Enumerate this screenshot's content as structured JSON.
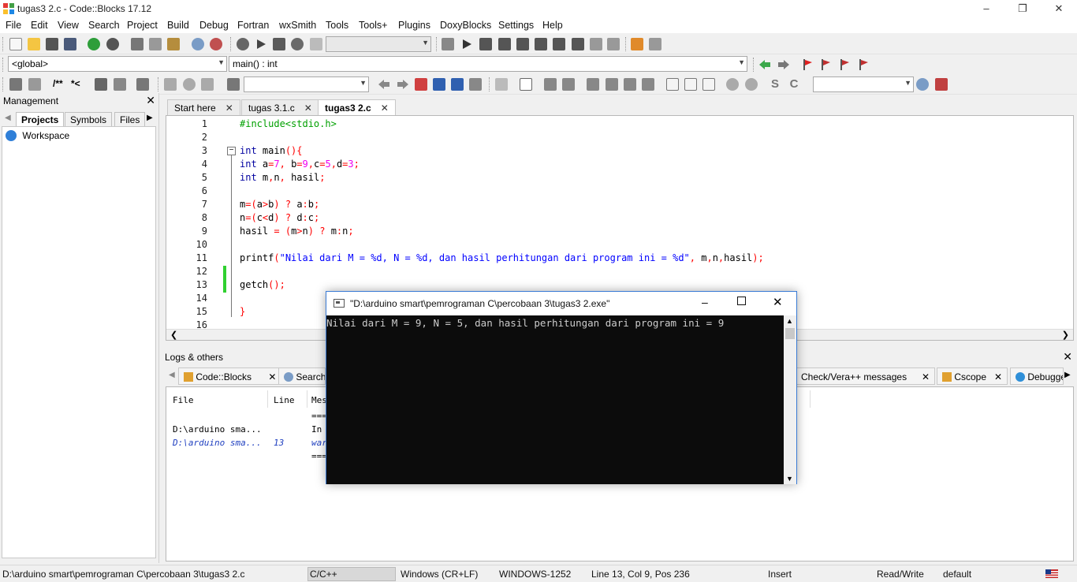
{
  "window": {
    "title": "tugas3 2.c - Code::Blocks 17.12"
  },
  "menu": [
    "File",
    "Edit",
    "View",
    "Search",
    "Project",
    "Build",
    "Debug",
    "Fortran",
    "wxSmith",
    "Tools",
    "Tools+",
    "Plugins",
    "DoxyBlocks",
    "Settings",
    "Help"
  ],
  "scope": {
    "left": "<global>",
    "right": "main() : int"
  },
  "doxy_toolbar": {
    "comment1": "/**",
    "comment2": "*<"
  },
  "management": {
    "title": "Management",
    "tabs": [
      "Projects",
      "Symbols",
      "Files"
    ],
    "tree_root": "Workspace"
  },
  "editor": {
    "tabs": [
      "Start here",
      "tugas 3.1.c",
      "tugas3 2.c"
    ],
    "lines": [
      {
        "n": "1",
        "html": "<span class=\"pp\">#include&lt;stdio.h&gt;</span>"
      },
      {
        "n": "2",
        "html": ""
      },
      {
        "n": "3",
        "html": "<span class=\"kw\">int</span> main<span class=\"op\">(){</span>"
      },
      {
        "n": "4",
        "html": "<span class=\"kw\">int</span> a<span class=\"op\">=</span><span class=\"num\">7</span><span class=\"op\">,</span> b<span class=\"op\">=</span><span class=\"num\">9</span><span class=\"op\">,</span>c<span class=\"op\">=</span><span class=\"num\">5</span><span class=\"op\">,</span>d<span class=\"op\">=</span><span class=\"num\">3</span><span class=\"op\">;</span>"
      },
      {
        "n": "5",
        "html": "<span class=\"kw\">int</span> m<span class=\"op\">,</span>n<span class=\"op\">,</span> hasil<span class=\"op\">;</span>"
      },
      {
        "n": "6",
        "html": ""
      },
      {
        "n": "7",
        "html": "m<span class=\"op\">=(</span>a<span class=\"op\">&gt;</span>b<span class=\"op\">)</span> <span class=\"op\">?</span> a<span class=\"op\">:</span>b<span class=\"op\">;</span>"
      },
      {
        "n": "8",
        "html": "n<span class=\"op\">=(</span>c<span class=\"op\">&lt;</span>d<span class=\"op\">)</span> <span class=\"op\">?</span> d<span class=\"op\">:</span>c<span class=\"op\">;</span>"
      },
      {
        "n": "9",
        "html": "hasil <span class=\"op\">=</span> <span class=\"op\">(</span>m<span class=\"op\">&gt;</span>n<span class=\"op\">)</span> <span class=\"op\">?</span> m<span class=\"op\">:</span>n<span class=\"op\">;</span>"
      },
      {
        "n": "10",
        "html": ""
      },
      {
        "n": "11",
        "html": "printf<span class=\"op\">(</span><span class=\"str\">\"Nilai dari M = %d, N = %d, dan hasil perhitungan dari program ini = %d\"</span><span class=\"op\">,</span> m<span class=\"op\">,</span>n<span class=\"op\">,</span>hasil<span class=\"op\">);</span>"
      },
      {
        "n": "12",
        "html": ""
      },
      {
        "n": "13",
        "html": "getch<span class=\"op\">();</span>"
      },
      {
        "n": "14",
        "html": ""
      },
      {
        "n": "15",
        "html": "<span class=\"op\">}</span>"
      },
      {
        "n": "16",
        "html": ""
      }
    ]
  },
  "logs": {
    "title": "Logs & others",
    "tabs": [
      "Code::Blocks",
      "Search",
      "Check/Vera++ messages",
      "Cscope",
      "Debugge"
    ],
    "headers": {
      "file": "File",
      "line": "Line",
      "message": "Mes"
    },
    "rows": [
      {
        "file": "",
        "line": "",
        "msg": "==="
      },
      {
        "file": "D:\\arduino sma...",
        "line": "",
        "msg": "In"
      },
      {
        "file": "D:\\arduino sma...",
        "line": "13",
        "msg": "war"
      },
      {
        "file": "",
        "line": "",
        "msg": "==="
      }
    ]
  },
  "console": {
    "title": "\"D:\\arduino smart\\pemrograman C\\percobaan 3\\tugas3 2.exe\"",
    "output": "Nilai dari M = 9, N = 5, dan hasil perhitungan dari program ini = 9"
  },
  "status": {
    "path": "D:\\arduino smart\\pemrograman C\\percobaan 3\\tugas3 2.c",
    "lang": "C/C++",
    "eol": "Windows (CR+LF)",
    "encoding": "WINDOWS-1252",
    "position": "Line 13, Col 9, Pos 236",
    "mode": "Insert",
    "access": "Read/Write",
    "theme": "default"
  }
}
